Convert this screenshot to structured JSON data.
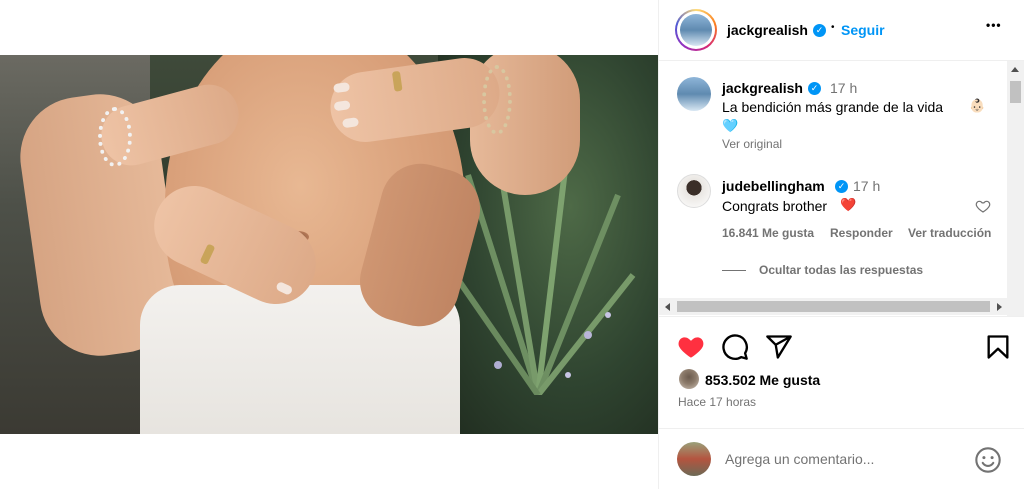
{
  "post": {
    "author": "jackgrealish",
    "follow_label": "Seguir",
    "separator": "•",
    "more_label": "•••"
  },
  "caption": {
    "author": "jackgrealish",
    "time": "17 h",
    "text": "La bendición más grande de la vida",
    "emoji_baby": "👶🏻",
    "emoji_heart": "🩵",
    "see_original": "Ver original"
  },
  "comments": [
    {
      "author": "judebellingham",
      "time": "17 h",
      "text": "Congrats brother",
      "emoji": "❤️",
      "likes": "16.841 Me gusta",
      "reply": "Responder",
      "translate": "Ver traducción",
      "hide_replies": "Ocultar todas las respuestas"
    }
  ],
  "engagement": {
    "likes": "853.502 Me gusta",
    "time_ago": "Hace 17 horas"
  },
  "comment_box": {
    "placeholder": "Agrega un comentario..."
  },
  "colors": {
    "accent": "#0095f6",
    "like_red": "#ff3040",
    "muted": "#737373",
    "divider": "#efefef"
  },
  "icons": {
    "verified": "verified-badge-icon",
    "like": "heart-filled-icon",
    "comment": "comment-icon",
    "share": "share-icon",
    "save": "bookmark-icon",
    "emoji": "emoji-icon",
    "more": "more-options-icon"
  }
}
